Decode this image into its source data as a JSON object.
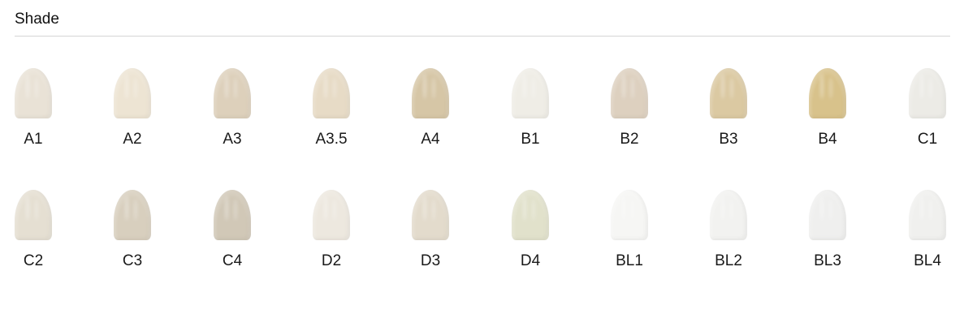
{
  "section": {
    "title": "Shade"
  },
  "shades": [
    {
      "label": "A1",
      "color": "#e9e2d6"
    },
    {
      "label": "A2",
      "color": "#ede4d3"
    },
    {
      "label": "A3",
      "color": "#ddd0bb"
    },
    {
      "label": "A3.5",
      "color": "#e7dbc6"
    },
    {
      "label": "A4",
      "color": "#d6c6a6"
    },
    {
      "label": "B1",
      "color": "#efede6"
    },
    {
      "label": "B2",
      "color": "#ddd0bf"
    },
    {
      "label": "B3",
      "color": "#dbc9a2"
    },
    {
      "label": "B4",
      "color": "#d8c28b"
    },
    {
      "label": "C1",
      "color": "#ecebe6"
    },
    {
      "label": "C2",
      "color": "#e5dfd2"
    },
    {
      "label": "C3",
      "color": "#d8cfbe"
    },
    {
      "label": "C4",
      "color": "#d1c8b7"
    },
    {
      "label": "D2",
      "color": "#ede8df"
    },
    {
      "label": "D3",
      "color": "#e3dbcc"
    },
    {
      "label": "D4",
      "color": "#e1e1cb"
    },
    {
      "label": "BL1",
      "color": "#f6f6f4"
    },
    {
      "label": "BL2",
      "color": "#f2f2f0"
    },
    {
      "label": "BL3",
      "color": "#efefee"
    },
    {
      "label": "BL4",
      "color": "#f0f0ee"
    }
  ]
}
